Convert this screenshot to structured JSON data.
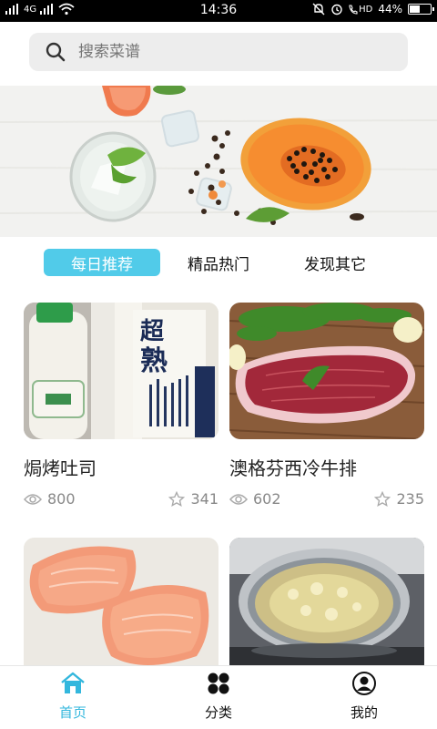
{
  "status_bar": {
    "left": "4G",
    "time": "14:36",
    "right_icons": [
      "bell-off-icon",
      "alarm-icon",
      "volte-icon"
    ],
    "volte": "HD",
    "battery": "44%",
    "battery_level": 0.44
  },
  "search": {
    "placeholder": "搜索菜谱"
  },
  "tabs": [
    {
      "label": "每日推荐",
      "active": true
    },
    {
      "label": "精品热门",
      "active": false
    },
    {
      "label": "发现其它",
      "active": false
    }
  ],
  "recipes": [
    {
      "title": "焗烤吐司",
      "views": "800",
      "stars": "341",
      "image": "toast-bread"
    },
    {
      "title": "澳格芬西冷牛排",
      "views": "602",
      "stars": "235",
      "image": "raw-steak"
    },
    {
      "title": "",
      "views": "",
      "stars": "",
      "image": "salmon"
    },
    {
      "title": "",
      "views": "",
      "stars": "",
      "image": "boiling-pot"
    }
  ],
  "bottom_nav": [
    {
      "label": "首页",
      "icon": "home-icon",
      "active": true
    },
    {
      "label": "分类",
      "icon": "category-icon",
      "active": false
    },
    {
      "label": "我的",
      "icon": "profile-icon",
      "active": false
    }
  ],
  "colors": {
    "accent": "#51cbe9",
    "active_nav": "#33b7dd"
  }
}
